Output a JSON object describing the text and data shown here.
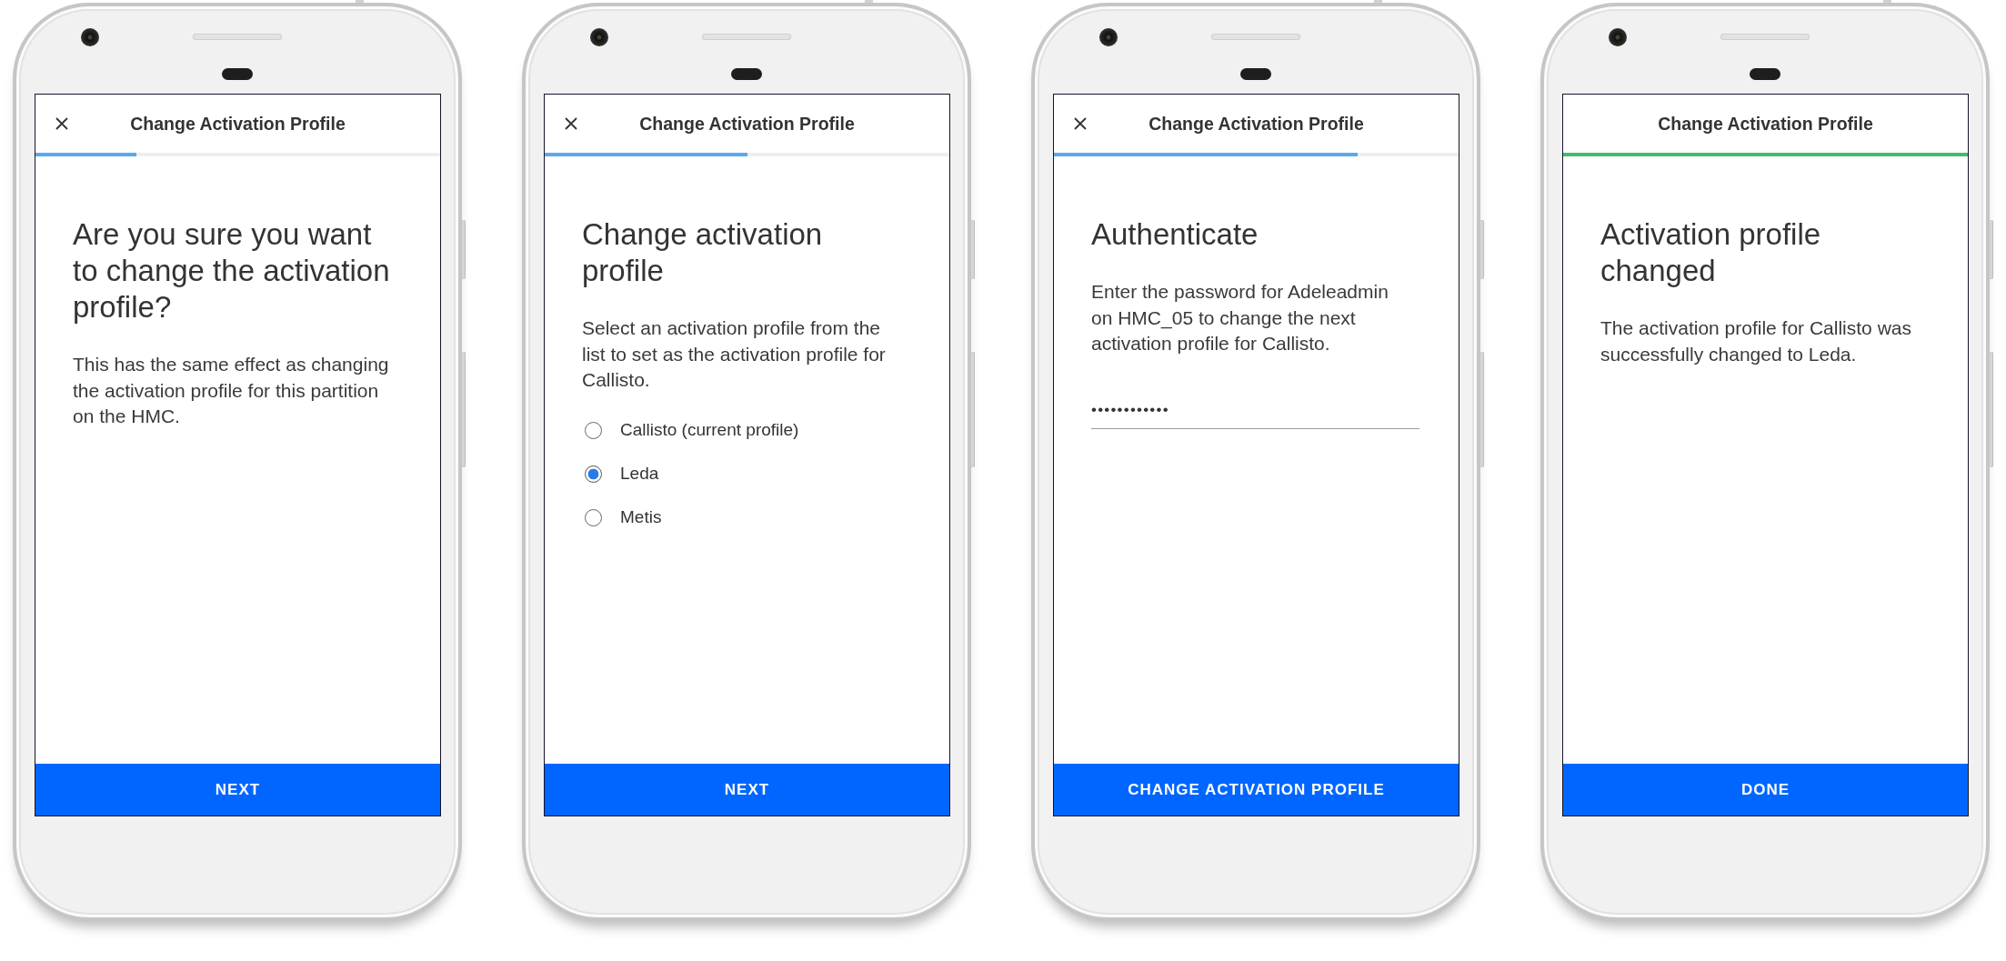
{
  "screens": [
    {
      "header": {
        "title": "Change Activation Profile",
        "close": true
      },
      "progress": {
        "level": 0.25,
        "complete": false
      },
      "content": [
        {
          "kind": "heading",
          "text": "Are you sure you want to change the activation profile?"
        },
        {
          "kind": "paragraph",
          "text": "This has the same effect as changing the activation profile for this partition on the HMC."
        }
      ],
      "action": {
        "label": "NEXT"
      }
    },
    {
      "header": {
        "title": "Change Activation Profile",
        "close": true
      },
      "progress": {
        "level": 0.5,
        "complete": false
      },
      "content": [
        {
          "kind": "heading",
          "text": "Change activation profile"
        },
        {
          "kind": "paragraph",
          "text": "Select an activation profile from the list to set as the activation profile for Callisto."
        },
        {
          "kind": "radio_group",
          "options": [
            {
              "label": "Callisto (current profile)",
              "selected": false
            },
            {
              "label": "Leda",
              "selected": true
            },
            {
              "label": "Metis",
              "selected": false
            }
          ]
        }
      ],
      "action": {
        "label": "NEXT"
      }
    },
    {
      "header": {
        "title": "Change Activation Profile",
        "close": true
      },
      "progress": {
        "level": 0.75,
        "complete": false
      },
      "content": [
        {
          "kind": "heading",
          "text": "Authenticate"
        },
        {
          "kind": "paragraph",
          "text": "Enter the password for Adeleadmin on HMC_05 to change the next activation profile for Callisto."
        },
        {
          "kind": "password_field",
          "value": "••••••••••••"
        }
      ],
      "action": {
        "label": "CHANGE ACTIVATION PROFILE"
      }
    },
    {
      "header": {
        "title": "Change Activation Profile",
        "close": false
      },
      "progress": {
        "level": 1,
        "complete": true
      },
      "content": [
        {
          "kind": "heading",
          "text": "Activation profile changed"
        },
        {
          "kind": "paragraph",
          "text": "The activation profile for Callisto was successfully changed to Leda."
        }
      ],
      "action": {
        "label": "DONE"
      }
    }
  ]
}
